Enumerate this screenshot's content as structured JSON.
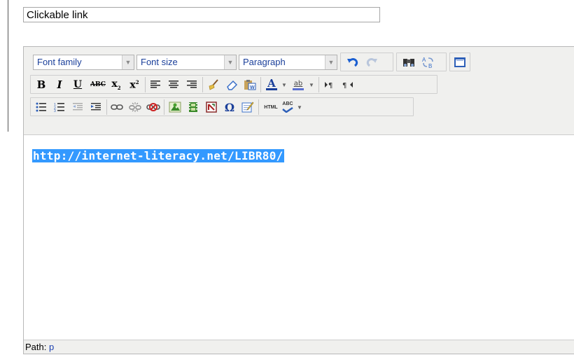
{
  "title_field": {
    "value": "Clickable link"
  },
  "toolbar": {
    "font_family": "Font family",
    "font_size": "Font size",
    "format": "Paragraph",
    "bold": "B",
    "italic": "I",
    "underline": "U",
    "strikethrough": "ABC",
    "subscript": "x",
    "superscript": "x",
    "forecolor": "A",
    "backcolor": "ab",
    "html": "HTML",
    "spell": "ABC",
    "omega": "Ω",
    "colors": {
      "undo": "#1b5fd1",
      "link": "#1b5fd1",
      "unlink": "#cc2222"
    }
  },
  "editor": {
    "content": "http://internet-literacy.net/LIBR80/"
  },
  "statusbar": {
    "path_label": "Path:",
    "path_value": "p"
  }
}
